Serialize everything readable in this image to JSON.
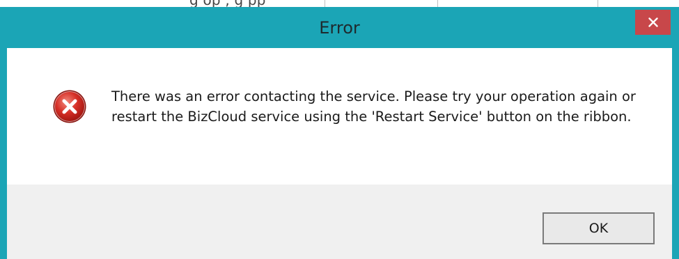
{
  "background": {
    "partial_text": "g op            ,              g                pp"
  },
  "dialog": {
    "title": "Error",
    "close_symbol": "✕",
    "icon": "error-icon",
    "message": "There was an error contacting the service. Please try your operation again or restart the BizCloud service using the 'Restart Service' button on the ribbon.",
    "ok_label": "OK"
  },
  "colors": {
    "title_bar": "#1ba5b6",
    "close_button": "#c8474a",
    "footer": "#f0f0f0",
    "error_red": "#d42b2b"
  }
}
